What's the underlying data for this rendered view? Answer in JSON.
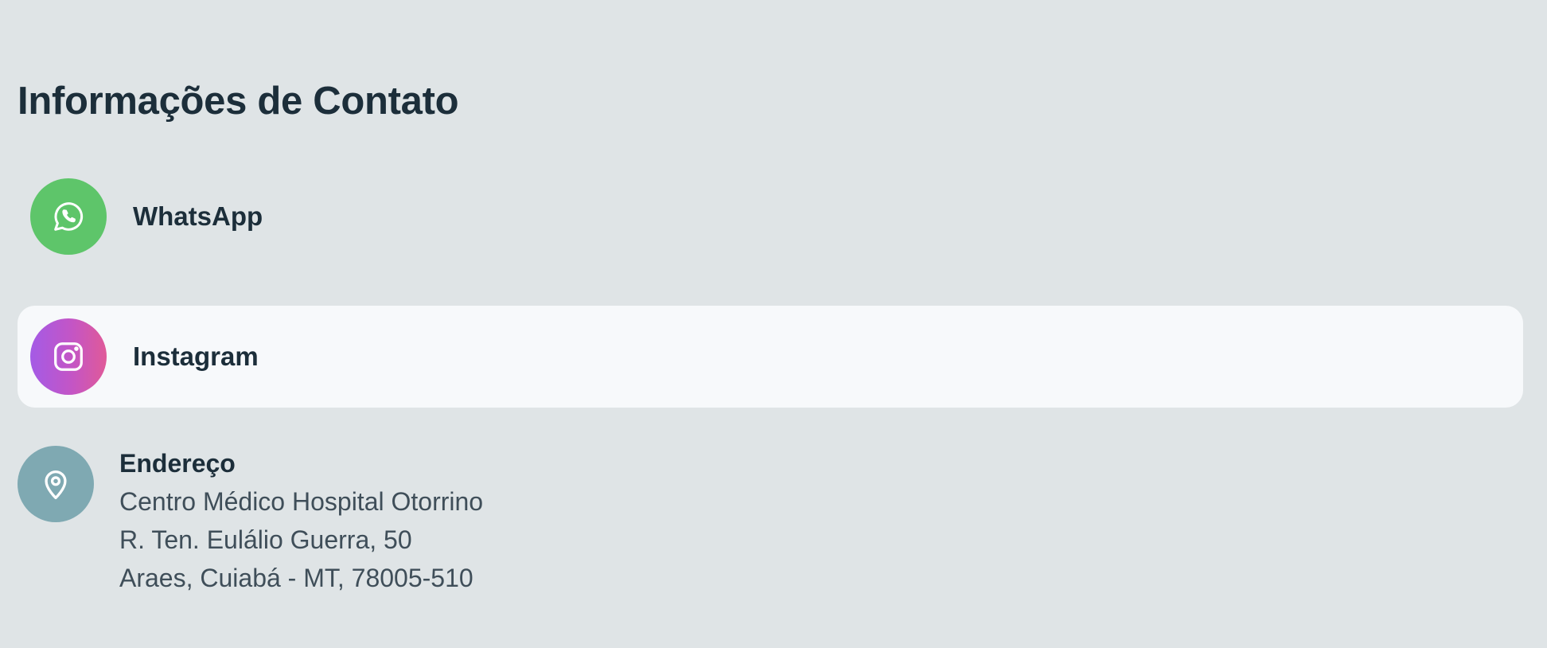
{
  "page": {
    "title": "Informações de Contato"
  },
  "contacts": [
    {
      "label": "WhatsApp",
      "icon": "whatsapp-icon",
      "color": "#5ec56a"
    },
    {
      "label": "Instagram",
      "icon": "instagram-icon",
      "gradient": [
        "#a45be6",
        "#e05a98"
      ]
    }
  ],
  "address": {
    "title": "Endereço",
    "icon": "location-pin-icon",
    "color": "#7fa9b2",
    "lines": [
      "Centro Médico Hospital Otorrino",
      "R. Ten. Eulálio Guerra, 50",
      "Araes, Cuiabá - MT, 78005-510"
    ]
  },
  "colors": {
    "background": "#dfe4e6",
    "card_highlight": "#f7f9fb",
    "text_primary": "#1c2e3a",
    "text_secondary": "#3f4e59"
  }
}
